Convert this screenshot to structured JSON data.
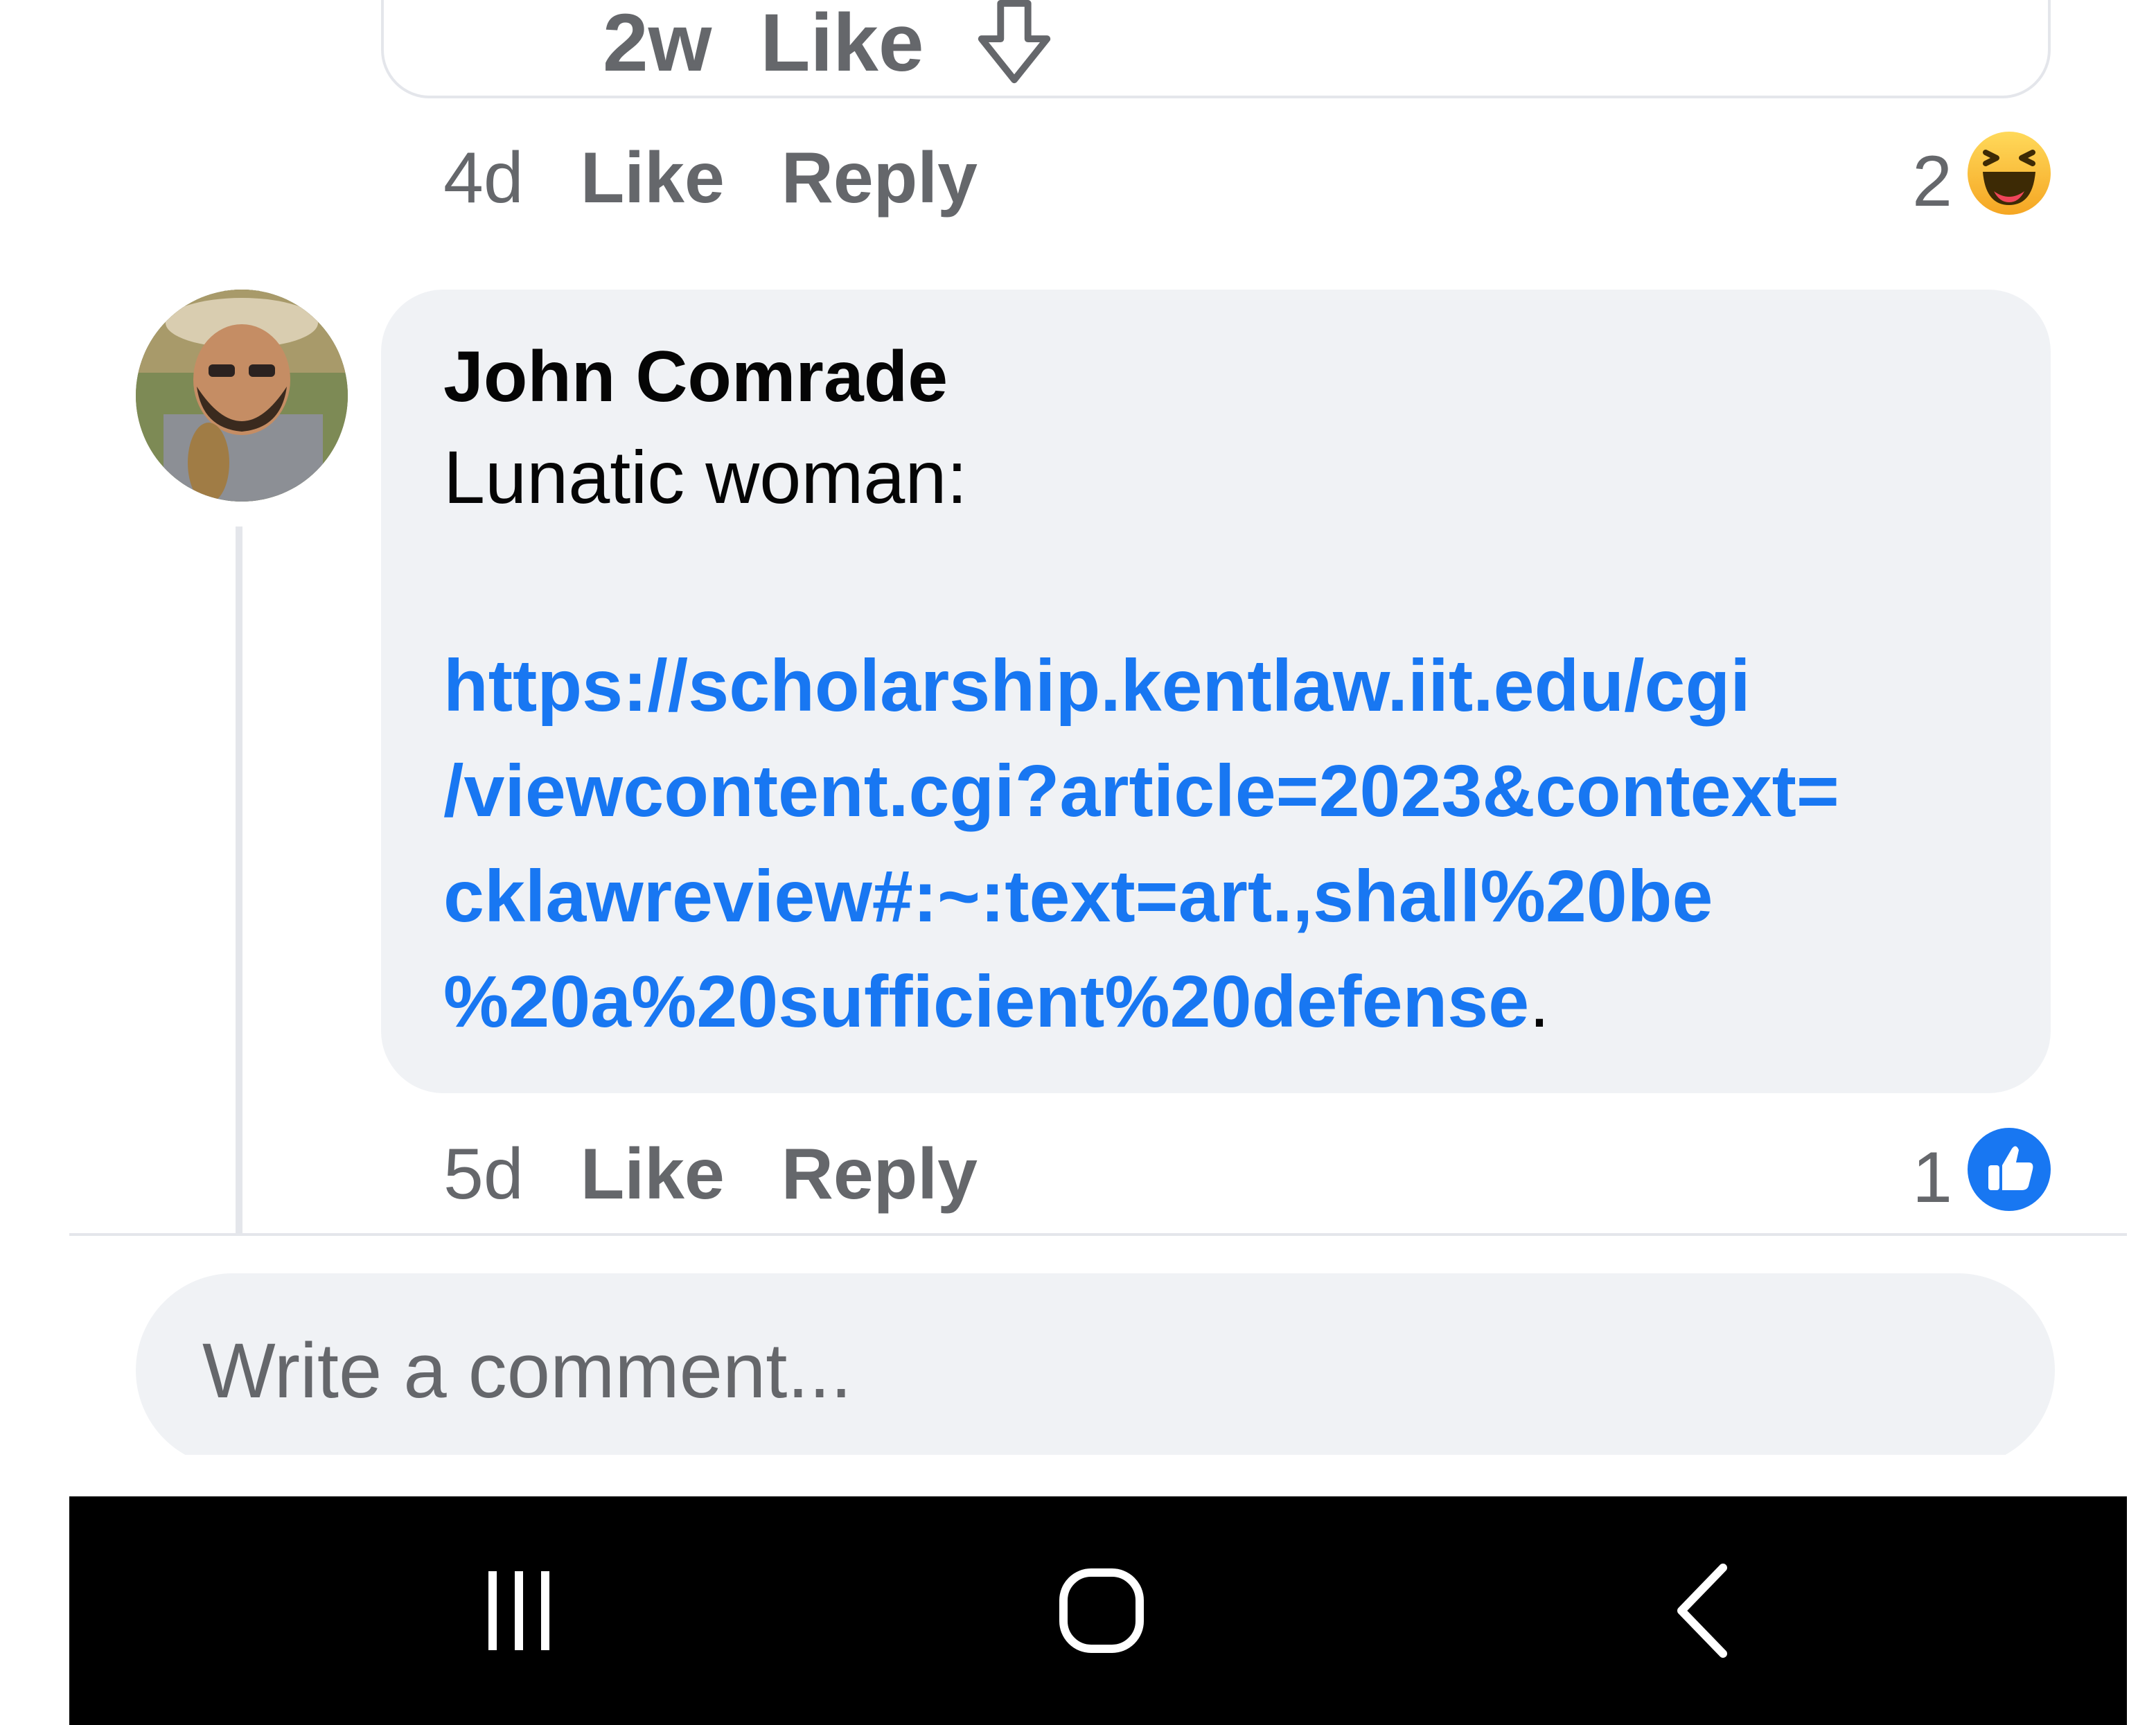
{
  "top_comment": {
    "time": "2w",
    "like_label": "Like",
    "dislike_icon": "arrow-down-outline-icon"
  },
  "first_actions": {
    "time": "4d",
    "like_label": "Like",
    "reply_label": "Reply",
    "reaction_count": "2",
    "reaction_icon": "haha-emoji-icon"
  },
  "comment": {
    "author": "John Comrade",
    "text": "Lunatic woman:",
    "link_lines": [
      "https://scholarship.kentlaw.iit.edu/cgi",
      "/viewcontent.cgi?article=2023&context=",
      "cklawreview#:~:text=art.,shall%20be",
      "%20a%20sufficient%20defense"
    ],
    "trailing_period": ".",
    "time": "5d",
    "like_label": "Like",
    "reply_label": "Reply",
    "reaction_count": "1",
    "reaction_icon": "like-thumb-icon"
  },
  "composer": {
    "placeholder": "Write a comment..."
  },
  "navbar": {
    "recents_icon": "recents-icon",
    "home_icon": "home-icon",
    "back_icon": "back-icon"
  },
  "colors": {
    "link": "#1877f2",
    "secondary_text": "#65676b",
    "bubble_bg": "#f0f2f5"
  }
}
